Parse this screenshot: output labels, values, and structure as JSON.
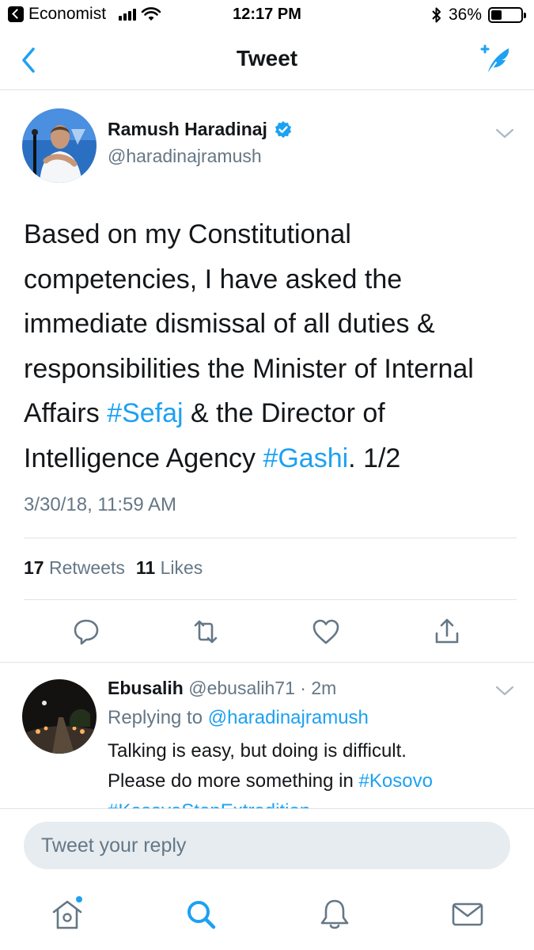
{
  "status_bar": {
    "back_app": "Economist",
    "time": "12:17 PM",
    "battery": "36%",
    "battery_level": 0.36
  },
  "nav": {
    "title": "Tweet"
  },
  "tweet": {
    "author_name": "Ramush Haradinaj",
    "handle": "@haradinajramush",
    "verified": true,
    "body": {
      "l1": "Based on my Constitutional",
      "l2": "competencies, I have asked the",
      "l3": "immediate dismissal of all duties &",
      "l4": "responsibilities the Minister of Internal",
      "l5a": "Affairs ",
      "l5_tag": "#Sefaj",
      "l5b": " & the Director of",
      "l6a": "Intelligence Agency ",
      "l6_tag": "#Gashi",
      "l6b": ". 1/2"
    },
    "timestamp": "3/30/18, 11:59 AM",
    "retweets_count": "17",
    "retweets_label": "Retweets",
    "likes_count": "11",
    "likes_label": "Likes"
  },
  "reply": {
    "name": "Ebusalih",
    "handle": "@ebusalih71",
    "sep": " · ",
    "time": "2m",
    "replying_label": "Replying to ",
    "replying_to": "@haradinajramush",
    "line1": "Talking is easy, but doing is difficult.",
    "line2a": "Please do more something in ",
    "line2_tag": "#Kosovo",
    "line3_tag": "#KosovoStopExtradition"
  },
  "composer": {
    "placeholder": "Tweet your reply"
  },
  "colors": {
    "accent": "#1da1f2",
    "secondary_text": "#657786",
    "primary_text": "#14171a",
    "divider": "#dfe4e8"
  },
  "icons": {
    "nav_back": "chevron-left-icon",
    "compose": "compose-tweet-icon",
    "verified": "verified-badge-icon",
    "reply": "reply-icon",
    "retweet": "retweet-icon",
    "like": "heart-icon",
    "share": "share-icon",
    "home": "home-icon",
    "search": "search-icon",
    "notifications": "bell-icon",
    "messages": "mail-icon"
  }
}
